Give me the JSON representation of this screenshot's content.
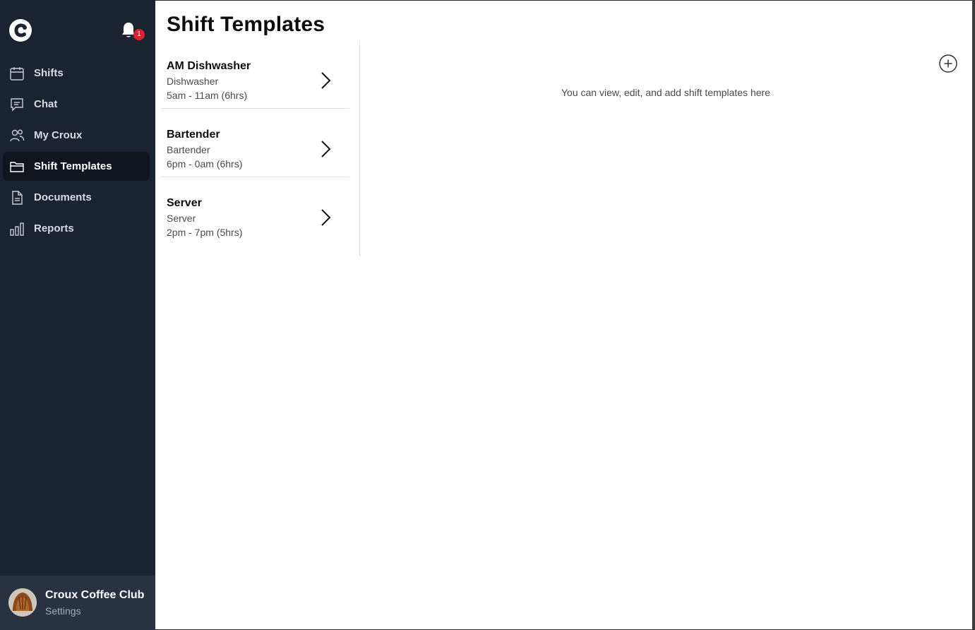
{
  "notifications": {
    "count": "1"
  },
  "sidebar": {
    "items": [
      {
        "label": "Shifts",
        "icon": "calendar-icon",
        "active": false
      },
      {
        "label": "Chat",
        "icon": "chat-icon",
        "active": false
      },
      {
        "label": "My Croux",
        "icon": "users-icon",
        "active": false
      },
      {
        "label": "Shift Templates",
        "icon": "folder-icon",
        "active": true
      },
      {
        "label": "Documents",
        "icon": "document-icon",
        "active": false
      },
      {
        "label": "Reports",
        "icon": "bar-chart-icon",
        "active": false
      }
    ]
  },
  "profile": {
    "name": "Croux Coffee Club",
    "settings_label": "Settings"
  },
  "main": {
    "title": "Shift Templates",
    "hint": "You can view, edit, and add shift templates here",
    "templates": [
      {
        "title": "AM Dishwasher",
        "role": "Dishwasher",
        "time": "5am - 11am (6hrs)"
      },
      {
        "title": "Bartender",
        "role": "Bartender",
        "time": "6pm - 0am (6hrs)"
      },
      {
        "title": "Server",
        "role": "Server",
        "time": "2pm - 7pm (5hrs)"
      }
    ]
  },
  "colors": {
    "sidebar_bg": "#1b2230",
    "sidebar_active_bg": "#10151e",
    "profile_bg": "#2a3140",
    "badge": "#e11d2e",
    "main_bg": "#ffffff"
  }
}
